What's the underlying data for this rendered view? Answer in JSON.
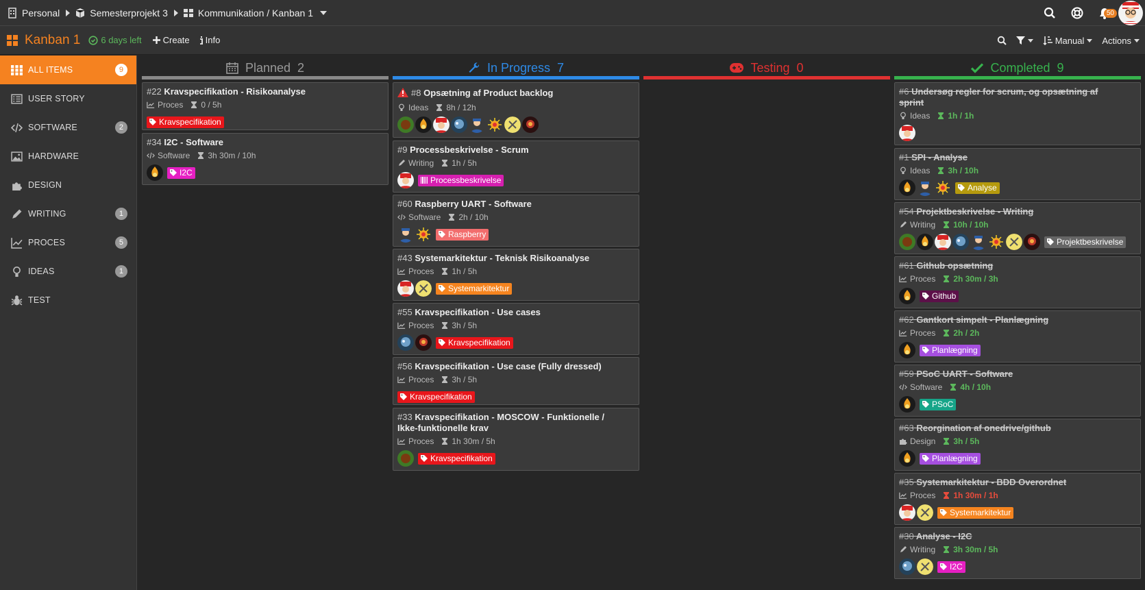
{
  "breadcrumb": {
    "items": [
      "Personal",
      "Semesterprojekt 3",
      "Kommunikation / Kanban 1"
    ]
  },
  "notifications": {
    "count": "50"
  },
  "board": {
    "title": "Kanban 1",
    "days_left": "6 days left",
    "create_label": "Create",
    "info_label": "Info",
    "sort_label": "Manual",
    "actions_label": "Actions"
  },
  "sidebar": {
    "items": [
      {
        "label": "ALL ITEMS",
        "count": "9",
        "icon": "grid-icon"
      },
      {
        "label": "USER STORY",
        "count": "",
        "icon": "list-icon"
      },
      {
        "label": "SOFTWARE",
        "count": "2",
        "icon": "code-icon"
      },
      {
        "label": "HARDWARE",
        "count": "",
        "icon": "image-icon"
      },
      {
        "label": "DESIGN",
        "count": "",
        "icon": "puzzle-icon"
      },
      {
        "label": "WRITING",
        "count": "1",
        "icon": "pencil-icon"
      },
      {
        "label": "PROCES",
        "count": "5",
        "icon": "chart-icon"
      },
      {
        "label": "IDEAS",
        "count": "1",
        "icon": "lightbulb-icon"
      },
      {
        "label": "TEST",
        "count": "",
        "icon": "bug-icon"
      }
    ]
  },
  "columns": [
    {
      "title": "Planned",
      "count": "2",
      "color": "#888888",
      "icon": "calendar-icon"
    },
    {
      "title": "In Progress",
      "count": "7",
      "color": "#2e8ae6",
      "icon": "wrench-icon"
    },
    {
      "title": "Testing",
      "count": "0",
      "color": "#e03131",
      "icon": "gamepad-icon"
    },
    {
      "title": "Completed",
      "count": "9",
      "color": "#37b24d",
      "icon": "check-icon"
    }
  ],
  "cards": {
    "planned": [
      {
        "num": "#22",
        "title": "Kravspecifikation - Risikoanalyse",
        "type": "Proces",
        "time": "0 / 5h",
        "tag": "Kravspecifikation",
        "tag_color": "#e8161b"
      },
      {
        "num": "#34",
        "title": "I2C - Software",
        "type": "Software",
        "time": "3h 30m / 10h",
        "tag": "I2C",
        "tag_color": "#e620c3"
      }
    ],
    "progress": [
      {
        "num": "#8",
        "title": "Opsætning af Product backlog",
        "type": "Ideas",
        "time": "8h / 12h"
      },
      {
        "num": "#9",
        "title": "Processbeskrivelse - Scrum",
        "type": "Writing",
        "time": "1h / 5h",
        "tag": "Processbeskrivelse",
        "tag_color": "#d61fb0"
      },
      {
        "num": "#60",
        "title": "Raspberry UART - Software",
        "type": "Software",
        "time": "2h / 10h",
        "tag": "Raspberry",
        "tag_color": "#f26d6d"
      },
      {
        "num": "#43",
        "title": "Systemarkitektur - Teknisk Risikoanalyse",
        "type": "Proces",
        "time": "1h / 5h",
        "tag": "Systemarkitektur",
        "tag_color": "#f5841f"
      },
      {
        "num": "#55",
        "title": "Kravspecifikation - Use cases",
        "type": "Proces",
        "time": "3h / 5h",
        "tag": "Kravspecifikation",
        "tag_color": "#e8161b"
      },
      {
        "num": "#56",
        "title": "Kravspecifikation - Use case (Fully dressed)",
        "type": "Proces",
        "time": "3h / 5h",
        "tag": "Kravspecifikation",
        "tag_color": "#e8161b"
      },
      {
        "num": "#33",
        "title": "Kravspecifikation - MOSCOW - Funktionelle /",
        "title2": "Ikke-funktionelle krav",
        "type": "Proces",
        "time": "1h 30m / 5h",
        "tag": "Kravspecifikation",
        "tag_color": "#e8161b"
      }
    ],
    "completed": [
      {
        "num": "#6",
        "title": "Undersøg regler for scrum, og opsætning af",
        "title2": "sprint",
        "type": "Ideas",
        "time": "1h / 1h"
      },
      {
        "num": "#1",
        "title": "SPI - Analyse",
        "type": "Ideas",
        "time": "3h / 10h",
        "tag": "Analyse",
        "tag_color": "#b59a0e"
      },
      {
        "num": "#54",
        "title": "Projektbeskrivelse - Writing",
        "type": "Writing",
        "time": "10h / 10h",
        "tag": "Projektbeskrivelse",
        "tag_color": "#666666"
      },
      {
        "num": "#61",
        "title": "Github opsætning",
        "type": "Proces",
        "time": "2h 30m / 3h",
        "tag": "Github",
        "tag_color": "#5c1049"
      },
      {
        "num": "#62",
        "title": "Gantkort simpelt - Planlægning",
        "type": "Proces",
        "time": "2h / 2h",
        "tag": "Planlægning",
        "tag_color": "#a64fe0"
      },
      {
        "num": "#59",
        "title": "PSoC UART - Software",
        "type": "Software",
        "time": "4h / 10h",
        "tag": "PSoC",
        "tag_color": "#17a589"
      },
      {
        "num": "#63",
        "title": "Reorgination af onedrive/github",
        "type": "Design",
        "time": "3h / 5h",
        "tag": "Planlægning",
        "tag_color": "#a64fe0"
      },
      {
        "num": "#35",
        "title": "Systemarkitektur - BDD Overordnet",
        "type": "Proces",
        "time": "1h 30m / 1h",
        "tag": "Systemarkitektur",
        "tag_color": "#f5841f"
      },
      {
        "num": "#30",
        "title": "Analyse - I2C",
        "type": "Writing",
        "time": "3h 30m / 5h",
        "tag": "I2C",
        "tag_color": "#e620c3"
      }
    ]
  }
}
